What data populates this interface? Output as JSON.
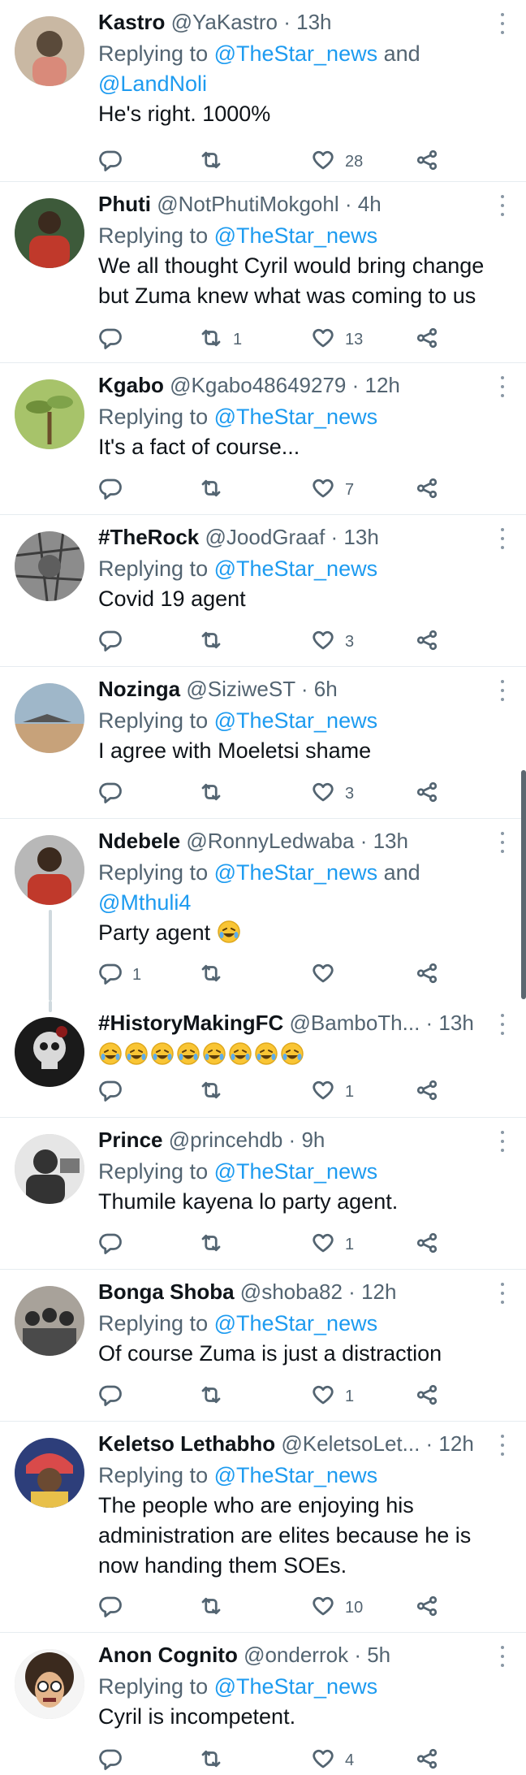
{
  "tweets": [
    {
      "name": "Kastro",
      "handle": "@YaKastro",
      "time": "13h",
      "reply_prefix": "Replying to ",
      "reply_lines": [
        [
          "@TheStar_news",
          " and"
        ],
        [
          "@LandNoli",
          ""
        ]
      ],
      "text_lines": [
        "He's right. 1000%"
      ],
      "emoji_count": 0,
      "replies": "",
      "retweets": "",
      "likes": "28",
      "avatar": "child-photo",
      "avatar_colors": [
        "#c9b8a3",
        "#5a4a3a"
      ]
    },
    {
      "name": "Phuti",
      "handle": "@NotPhutiMokgohl",
      "time": "4h",
      "reply_prefix": "Replying to ",
      "reply_lines": [
        [
          "@TheStar_news",
          ""
        ]
      ],
      "text_lines": [
        "We all thought Cyril would bring change",
        "but Zuma knew what was coming to us"
      ],
      "emoji_count": 0,
      "replies": "",
      "retweets": "1",
      "likes": "13",
      "avatar": "man-red-shirt",
      "avatar_colors": [
        "#3d5a3a",
        "#c0392b"
      ]
    },
    {
      "name": "Kgabo",
      "handle": "@Kgabo48649279",
      "time": "12h",
      "reply_prefix": "Replying to ",
      "reply_lines": [
        [
          "@TheStar_news",
          ""
        ]
      ],
      "text_lines": [
        "It's a fact of course..."
      ],
      "emoji_count": 0,
      "replies": "",
      "retweets": "",
      "likes": "7",
      "avatar": "plant",
      "avatar_colors": [
        "#a7c36a",
        "#6b4e2a"
      ]
    },
    {
      "name": "#TheRock",
      "handle": "@JoodGraaf",
      "time": "13h",
      "reply_prefix": "Replying to ",
      "reply_lines": [
        [
          "@TheStar_news",
          ""
        ]
      ],
      "text_lines": [
        "Covid 19 agent"
      ],
      "emoji_count": 0,
      "replies": "",
      "retweets": "",
      "likes": "3",
      "avatar": "grey-texture",
      "avatar_colors": [
        "#8c8c8c",
        "#3c3c3c"
      ]
    },
    {
      "name": "Nozinga",
      "handle": "@SiziweST",
      "time": "6h",
      "reply_prefix": "Replying to ",
      "reply_lines": [
        [
          "@TheStar_news",
          ""
        ]
      ],
      "text_lines": [
        "I agree with Moeletsi shame"
      ],
      "emoji_count": 0,
      "replies": "",
      "retweets": "",
      "likes": "3",
      "avatar": "beach",
      "avatar_colors": [
        "#9fb7c9",
        "#c7a27a"
      ]
    },
    {
      "name": "Ndebele",
      "handle": "@RonnyLedwaba",
      "time": "13h",
      "reply_prefix": "Replying to ",
      "reply_lines": [
        [
          "@TheStar_news",
          " and"
        ],
        [
          "@Mthuli4",
          ""
        ]
      ],
      "text_lines": [
        "Party agent "
      ],
      "emoji_count": 1,
      "replies": "1",
      "retweets": "",
      "likes": "",
      "avatar": "man-red",
      "avatar_colors": [
        "#b8b8b8",
        "#c0392b"
      ]
    },
    {
      "name": "#HistoryMakingFC",
      "handle": "@BamboTh...",
      "time": "13h",
      "reply_prefix": "",
      "reply_lines": [],
      "text_lines": [
        ""
      ],
      "emoji_count": 8,
      "replies": "",
      "retweets": "",
      "likes": "1",
      "avatar": "skull",
      "avatar_colors": [
        "#1a1a1a",
        "#d9d9d9"
      ]
    },
    {
      "name": "Prince",
      "handle": "@princehdb",
      "time": "9h",
      "reply_prefix": "Replying to ",
      "reply_lines": [
        [
          "@TheStar_news",
          ""
        ]
      ],
      "text_lines": [
        "Thumile kayena lo party agent."
      ],
      "emoji_count": 0,
      "replies": "",
      "retweets": "",
      "likes": "1",
      "avatar": "bw-portrait",
      "avatar_colors": [
        "#e6e6e6",
        "#333333"
      ]
    },
    {
      "name": "Bonga Shoba",
      "handle": "@shoba82",
      "time": "12h",
      "reply_prefix": "Replying to ",
      "reply_lines": [
        [
          "@TheStar_news",
          ""
        ]
      ],
      "text_lines": [
        "Of course Zuma is just a distraction"
      ],
      "emoji_count": 0,
      "replies": "",
      "retweets": "",
      "likes": "1",
      "avatar": "group-photo",
      "avatar_colors": [
        "#a8a29a",
        "#2b2b2b"
      ]
    },
    {
      "name": "Keletso Lethabho",
      "handle": "@KeletsoLet...",
      "time": "12h",
      "reply_prefix": "Replying to ",
      "reply_lines": [
        [
          "@TheStar_news",
          ""
        ]
      ],
      "text_lines": [
        "The people who are enjoying his",
        "administration are elites because he is",
        "now handing them SOEs."
      ],
      "emoji_count": 0,
      "replies": "",
      "retweets": "",
      "likes": "10",
      "avatar": "colorful-headwrap",
      "avatar_colors": [
        "#2d3e7a",
        "#d94a4a"
      ]
    },
    {
      "name": "Anon Cognito",
      "handle": "@onderrok",
      "time": "5h",
      "reply_prefix": "Replying to ",
      "reply_lines": [
        [
          "@TheStar_news",
          ""
        ]
      ],
      "text_lines": [
        "Cyril is incompetent."
      ],
      "emoji_count": 0,
      "replies": "",
      "retweets": "",
      "likes": "4",
      "avatar": "cartoon-afro",
      "avatar_colors": [
        "#f5f5f5",
        "#3b2a1e"
      ]
    }
  ],
  "icons": {
    "reply": "reply-icon",
    "retweet": "retweet-icon",
    "like": "heart-icon",
    "share": "share-icon",
    "more": "more-vertical-icon",
    "emoji": "rolling-laughing-emoji"
  },
  "colors": {
    "link": "#1d9bf0",
    "secondary": "#536471",
    "divider": "#e6ecf0",
    "thread_line": "#cfd9de"
  }
}
